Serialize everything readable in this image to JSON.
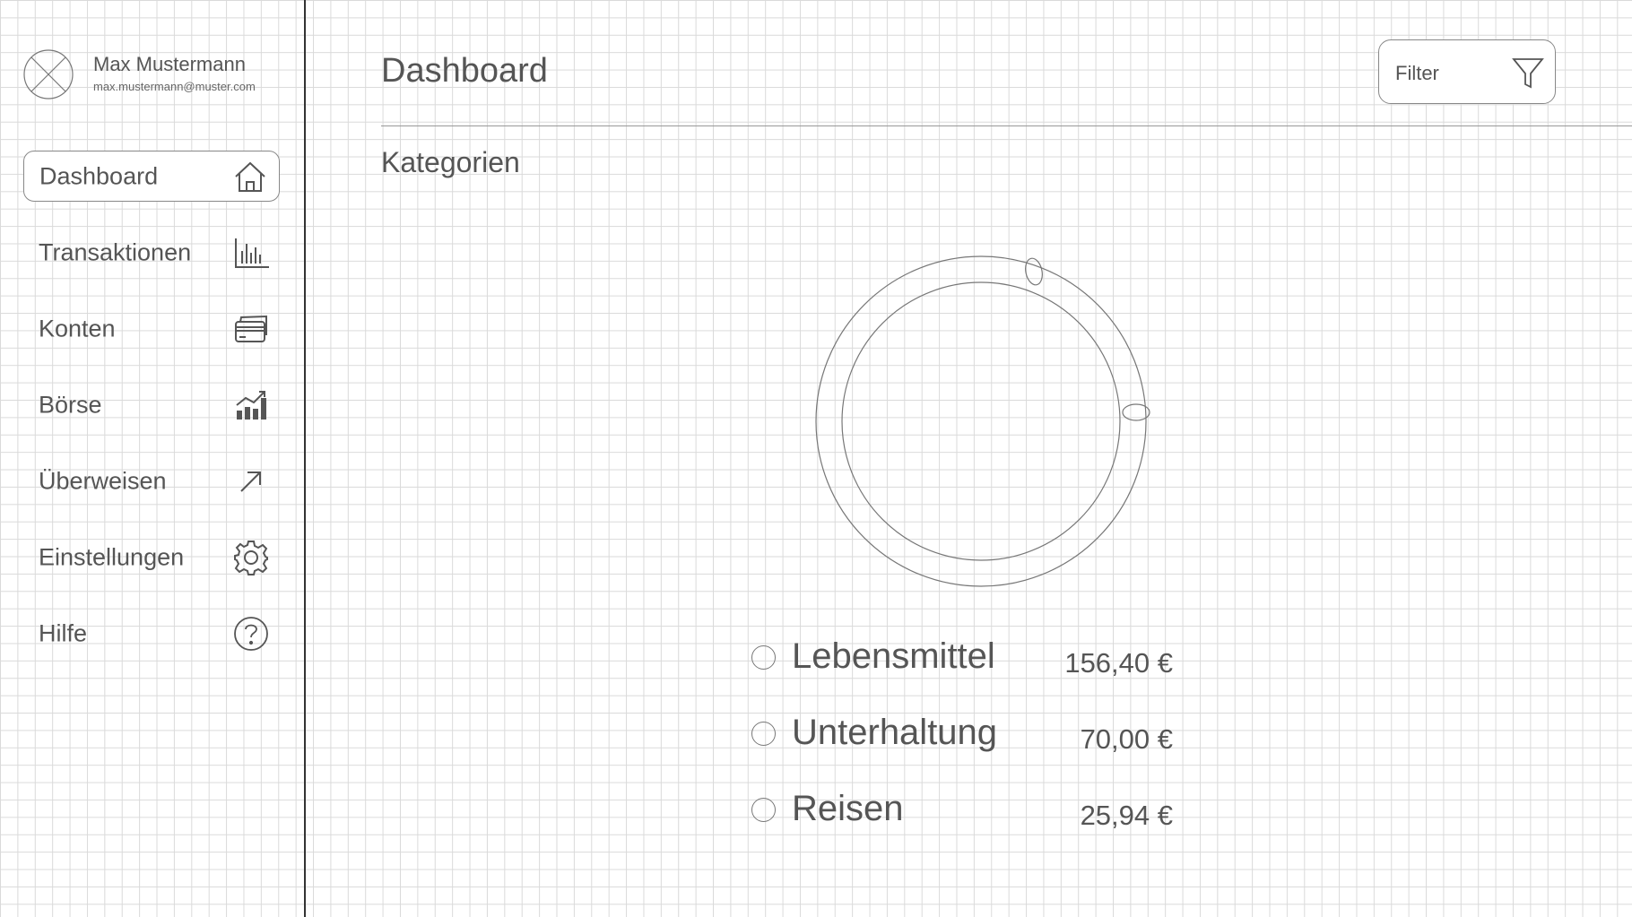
{
  "user": {
    "name": "Max Mustermann",
    "email": "max.mustermann@muster.com"
  },
  "nav": {
    "items": [
      {
        "label": "Dashboard",
        "icon": "home-icon",
        "active": true
      },
      {
        "label": "Transaktionen",
        "icon": "bar-chart-icon",
        "active": false
      },
      {
        "label": "Konten",
        "icon": "credit-card-icon",
        "active": false
      },
      {
        "label": "Börse",
        "icon": "stock-chart-icon",
        "active": false
      },
      {
        "label": "Überweisen",
        "icon": "arrow-up-right-icon",
        "active": false
      },
      {
        "label": "Einstellungen",
        "icon": "gear-icon",
        "active": false
      },
      {
        "label": "Hilfe",
        "icon": "help-icon",
        "active": false
      }
    ]
  },
  "header": {
    "title": "Dashboard",
    "filter_label": "Filter"
  },
  "section": {
    "title": "Kategorien"
  },
  "categories": [
    {
      "name": "Lebensmittel",
      "amount": "156,40 €"
    },
    {
      "name": "Unterhaltung",
      "amount": "70,00 €"
    },
    {
      "name": "Reisen",
      "amount": "25,94 €"
    }
  ],
  "colors": {
    "line": "#777777",
    "grid": "#dadada",
    "divider": "#333333"
  }
}
